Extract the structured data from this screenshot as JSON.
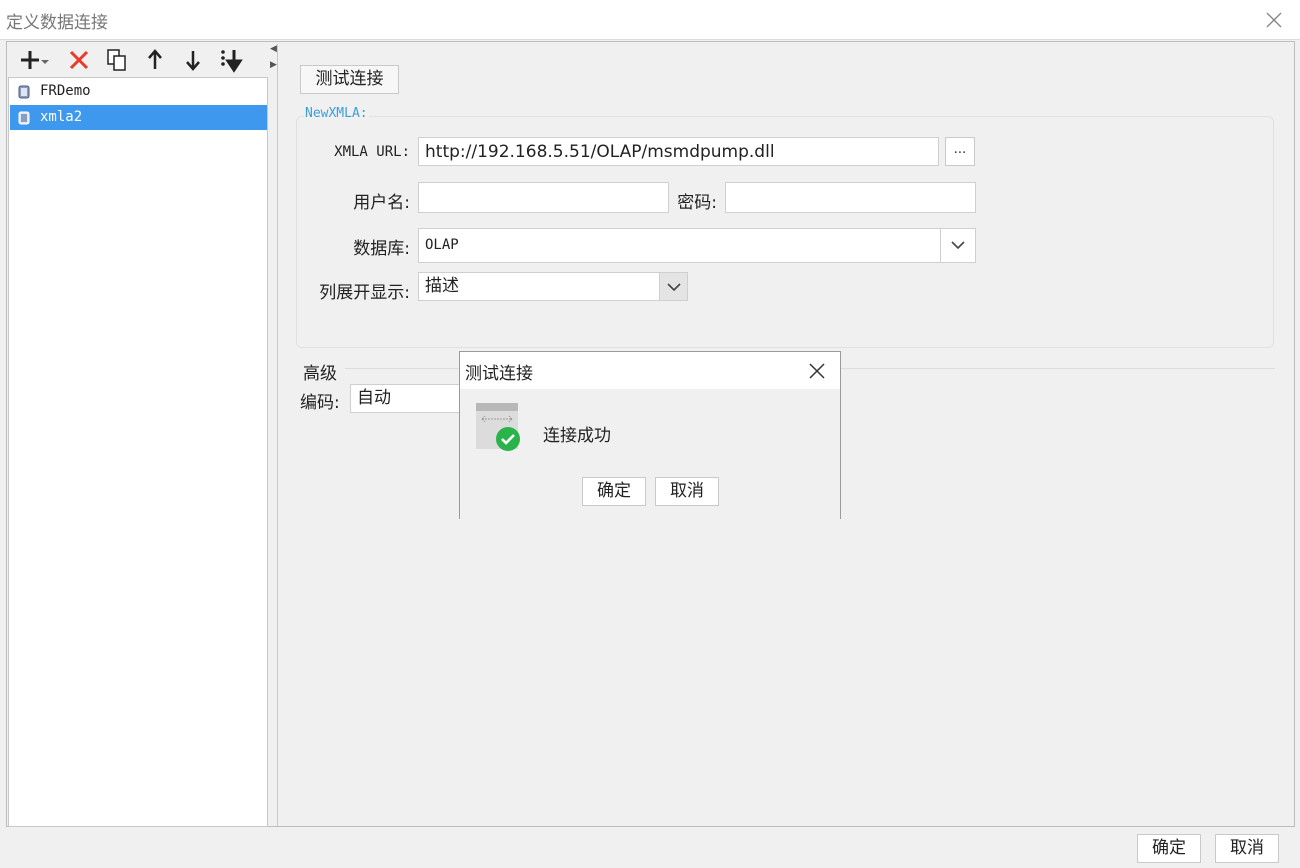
{
  "window": {
    "title": "定义数据连接",
    "close_icon": "close-icon"
  },
  "toolbar": {
    "icons": [
      "add-icon",
      "dropdown-arrow-icon",
      "delete-icon",
      "copy-icon",
      "move-up-icon",
      "move-down-icon",
      "sort-icon"
    ]
  },
  "connections": [
    {
      "name": "FRDemo",
      "selected": false
    },
    {
      "name": "xmla2",
      "selected": true
    }
  ],
  "form": {
    "test_button": "测试连接",
    "group_title": "NewXMLA:",
    "url_label": "XMLA URL:",
    "url_value": "http://192.168.5.51/OLAP/msmdpump.dll",
    "browse_button": "...",
    "username_label": "用户名:",
    "username_value": "",
    "password_label": "密码:",
    "password_value": "",
    "database_label": "数据库:",
    "database_value": "OLAP",
    "column_display_label": "列展开显示:",
    "column_display_value": "描述",
    "advanced_label": "高级",
    "encoding_label": "编码:",
    "encoding_value": "自动"
  },
  "dialog": {
    "title": "测试连接",
    "message": "连接成功",
    "ok": "确定",
    "cancel": "取消",
    "status_color": "#2ab34a"
  },
  "footer": {
    "ok": "确定",
    "cancel": "取消"
  },
  "colors": {
    "selection": "#3d98ee",
    "delete_red": "#e8392b",
    "legend_blue": "#3b9fd8"
  }
}
